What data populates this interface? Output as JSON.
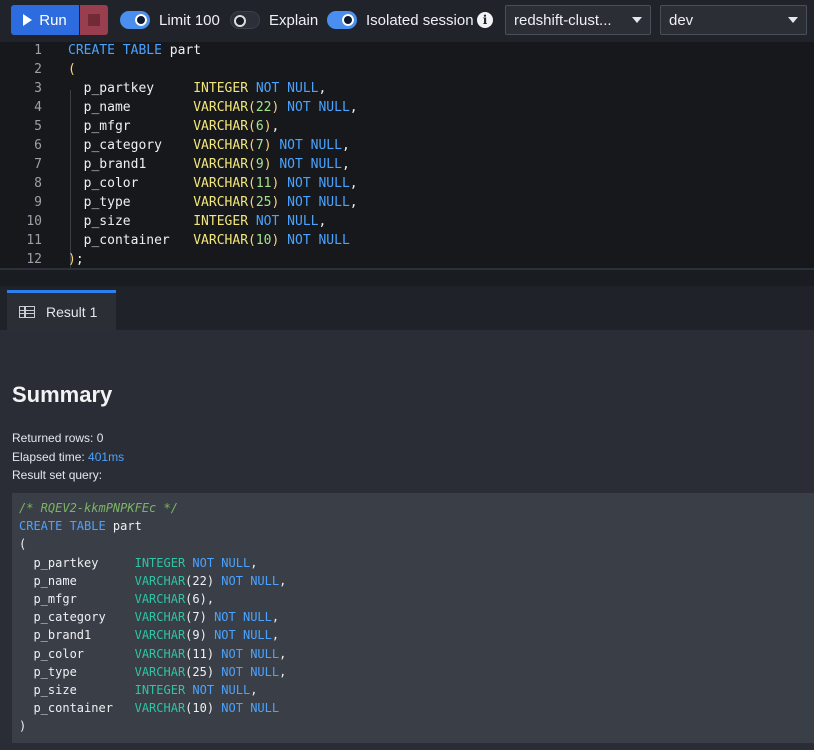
{
  "toolbar": {
    "run_label": "Run",
    "limit": {
      "label": "Limit 100",
      "on": true
    },
    "explain": {
      "label": "Explain",
      "on": false
    },
    "isolated": {
      "label": "Isolated session",
      "on": true
    },
    "cluster_select": "redshift-clust...",
    "database_select": "dev"
  },
  "editor": {
    "lines": [
      {
        "n": "1",
        "tokens": [
          [
            "kw",
            "CREATE TABLE "
          ],
          [
            "id",
            "part"
          ]
        ]
      },
      {
        "n": "2",
        "tokens": [
          [
            "pa",
            "("
          ]
        ]
      },
      {
        "n": "3",
        "tokens": [
          [
            "id",
            "  p_partkey     "
          ],
          [
            "ty",
            "INTEGER "
          ],
          [
            "kw",
            "NOT NULL"
          ],
          [
            "id",
            ","
          ]
        ]
      },
      {
        "n": "4",
        "tokens": [
          [
            "id",
            "  p_name        "
          ],
          [
            "ty",
            "VARCHAR"
          ],
          [
            "pa",
            "("
          ],
          [
            "nu",
            "22"
          ],
          [
            "pa",
            ")"
          ],
          [
            "kw",
            " NOT NULL"
          ],
          [
            "id",
            ","
          ]
        ]
      },
      {
        "n": "5",
        "tokens": [
          [
            "id",
            "  p_mfgr        "
          ],
          [
            "ty",
            "VARCHAR"
          ],
          [
            "pa",
            "("
          ],
          [
            "nu",
            "6"
          ],
          [
            "pa",
            ")"
          ],
          [
            "id",
            ","
          ]
        ]
      },
      {
        "n": "6",
        "tokens": [
          [
            "id",
            "  p_category    "
          ],
          [
            "ty",
            "VARCHAR"
          ],
          [
            "pa",
            "("
          ],
          [
            "nu",
            "7"
          ],
          [
            "pa",
            ")"
          ],
          [
            "kw",
            " NOT NULL"
          ],
          [
            "id",
            ","
          ]
        ]
      },
      {
        "n": "7",
        "tokens": [
          [
            "id",
            "  p_brand1      "
          ],
          [
            "ty",
            "VARCHAR"
          ],
          [
            "pa",
            "("
          ],
          [
            "nu",
            "9"
          ],
          [
            "pa",
            ")"
          ],
          [
            "kw",
            " NOT NULL"
          ],
          [
            "id",
            ","
          ]
        ]
      },
      {
        "n": "8",
        "tokens": [
          [
            "id",
            "  p_color       "
          ],
          [
            "ty",
            "VARCHAR"
          ],
          [
            "pa",
            "("
          ],
          [
            "nu",
            "11"
          ],
          [
            "pa",
            ")"
          ],
          [
            "kw",
            " NOT NULL"
          ],
          [
            "id",
            ","
          ]
        ]
      },
      {
        "n": "9",
        "tokens": [
          [
            "id",
            "  p_type        "
          ],
          [
            "ty",
            "VARCHAR"
          ],
          [
            "pa",
            "("
          ],
          [
            "nu",
            "25"
          ],
          [
            "pa",
            ")"
          ],
          [
            "kw",
            " NOT NULL"
          ],
          [
            "id",
            ","
          ]
        ]
      },
      {
        "n": "10",
        "tokens": [
          [
            "id",
            "  p_size        "
          ],
          [
            "ty",
            "INTEGER "
          ],
          [
            "kw",
            "NOT NULL"
          ],
          [
            "id",
            ","
          ]
        ]
      },
      {
        "n": "11",
        "tokens": [
          [
            "id",
            "  p_container   "
          ],
          [
            "ty",
            "VARCHAR"
          ],
          [
            "pa",
            "("
          ],
          [
            "nu",
            "10"
          ],
          [
            "pa",
            ")"
          ],
          [
            "kw",
            " NOT NULL"
          ]
        ]
      },
      {
        "n": "12",
        "tokens": [
          [
            "pa",
            ")"
          ],
          [
            "id",
            ";"
          ]
        ]
      }
    ]
  },
  "results": {
    "tab_label": "Result 1",
    "summary_title": "Summary",
    "returned_rows_label": "Returned rows: 0",
    "elapsed_label": "Elapsed time: ",
    "elapsed_value": "401ms",
    "result_query_label": "Result set query:",
    "query_lines": [
      [
        [
          "cm",
          "/* RQEV2-kkmPNPKFEc */"
        ]
      ],
      [
        [
          "qkw",
          "CREATE TABLE "
        ],
        [
          "id",
          "part"
        ]
      ],
      [
        [
          "id",
          "("
        ]
      ],
      [
        [
          "id",
          "  p_partkey     "
        ],
        [
          "qty",
          "INTEGER "
        ],
        [
          "qkw",
          "NOT NULL"
        ],
        [
          "id",
          ","
        ]
      ],
      [
        [
          "id",
          "  p_name        "
        ],
        [
          "qty",
          "VARCHAR"
        ],
        [
          "id",
          "(22) "
        ],
        [
          "qkw",
          "NOT NULL"
        ],
        [
          "id",
          ","
        ]
      ],
      [
        [
          "id",
          "  p_mfgr        "
        ],
        [
          "qty",
          "VARCHAR"
        ],
        [
          "id",
          "(6),"
        ]
      ],
      [
        [
          "id",
          "  p_category    "
        ],
        [
          "qty",
          "VARCHAR"
        ],
        [
          "id",
          "(7) "
        ],
        [
          "qkw",
          "NOT NULL"
        ],
        [
          "id",
          ","
        ]
      ],
      [
        [
          "id",
          "  p_brand1      "
        ],
        [
          "qty",
          "VARCHAR"
        ],
        [
          "id",
          "(9) "
        ],
        [
          "qkw",
          "NOT NULL"
        ],
        [
          "id",
          ","
        ]
      ],
      [
        [
          "id",
          "  p_color       "
        ],
        [
          "qty",
          "VARCHAR"
        ],
        [
          "id",
          "(11) "
        ],
        [
          "qkw",
          "NOT NULL"
        ],
        [
          "id",
          ","
        ]
      ],
      [
        [
          "id",
          "  p_type        "
        ],
        [
          "qty",
          "VARCHAR"
        ],
        [
          "id",
          "(25) "
        ],
        [
          "qkw",
          "NOT NULL"
        ],
        [
          "id",
          ","
        ]
      ],
      [
        [
          "id",
          "  p_size        "
        ],
        [
          "qty",
          "INTEGER "
        ],
        [
          "qkw",
          "NOT NULL"
        ],
        [
          "id",
          ","
        ]
      ],
      [
        [
          "id",
          "  p_container   "
        ],
        [
          "qty",
          "VARCHAR"
        ],
        [
          "id",
          "(10) "
        ],
        [
          "qkw",
          "NOT NULL"
        ]
      ],
      [
        [
          "id",
          ")"
        ]
      ]
    ]
  }
}
